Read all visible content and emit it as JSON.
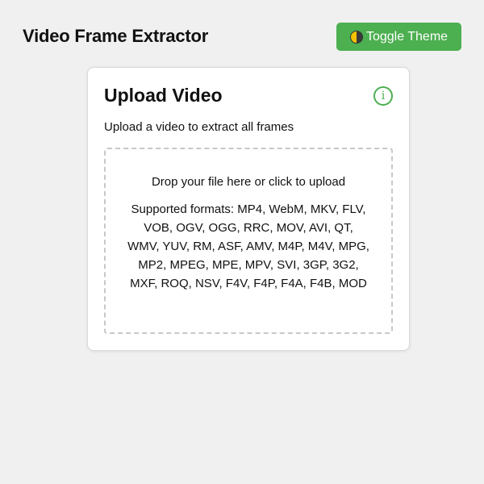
{
  "app": {
    "title": "Video Frame Extractor"
  },
  "toolbar": {
    "theme_button_label": "Toggle Theme",
    "theme_icon": "half-moon-icon"
  },
  "upload_card": {
    "title": "Upload Video",
    "info_icon_glyph": "i",
    "description": "Upload a video to extract all frames",
    "dropzone": {
      "prompt": "Drop your file here or click to upload",
      "formats": "Supported formats: MP4, WebM, MKV, FLV, VOB, OGV, OGG, RRC, MOV, AVI, QT, WMV, YUV, RM, ASF, AMV, M4P, M4V, MPG, MP2, MPEG, MPE, MPV, SVI, 3GP, 3G2, MXF, ROQ, NSV, F4V, F4P, F4A, F4B, MOD"
    }
  },
  "colors": {
    "accent": "#4caf50",
    "background": "#f0f0f0",
    "card": "#ffffff"
  }
}
